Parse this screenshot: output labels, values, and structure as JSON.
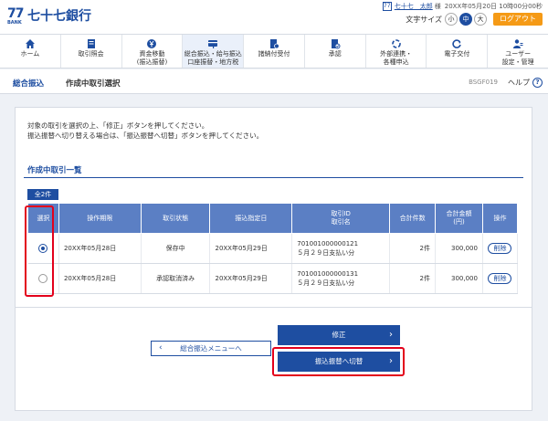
{
  "header": {
    "logo_mark": "77",
    "logo_sub": "BANK",
    "bank_name": "七十七銀行",
    "user_icon": "user-card-icon",
    "user_name": "七十七　太郎",
    "user_suffix": "様",
    "login_time": "20XX年05月20日 10時00分00秒",
    "font_size_label": "文字サイズ",
    "font_sizes": [
      "小",
      "中",
      "大"
    ],
    "font_size_selected": "中",
    "logout_label": "ログアウト"
  },
  "nav": {
    "items": [
      {
        "label": "ホーム",
        "icon": "home-icon"
      },
      {
        "label": "取引照会",
        "icon": "document-icon"
      },
      {
        "label": "資金移動\n(振込振替)",
        "icon": "yen-icon"
      },
      {
        "label": "総合振込・給与振込\n口座振替・地方税",
        "icon": "card-icon"
      },
      {
        "label": "諸納付受付",
        "icon": "payment-icon"
      },
      {
        "label": "承認",
        "icon": "approve-icon"
      },
      {
        "label": "外部連携・\n各種申込",
        "icon": "link-icon"
      },
      {
        "label": "電子交付",
        "icon": "refresh-icon"
      },
      {
        "label": "ユーザー\n設定・管理",
        "icon": "user-settings-icon"
      }
    ],
    "active_index": 3
  },
  "breadcrumb": {
    "parent": "総合振込",
    "current": "作成中取引選択",
    "screen_id": "BSGF019",
    "help_label": "ヘルプ",
    "help_icon": "help-icon"
  },
  "instructions": {
    "line1": "対象の取引を選択の上、「修正」ボタンを押してください。",
    "line2": "振込振替へ切り替える場合は、「振込振替へ切替」ボタンを押してください。"
  },
  "list": {
    "title": "作成中取引一覧",
    "count": "全2件",
    "headers": [
      "選択",
      "操作期限",
      "取引状態",
      "振込指定日",
      "取引ID\n取引名",
      "合計件数",
      "合計金額\n(円)",
      "操作"
    ],
    "rows": [
      {
        "selected": true,
        "deadline": "20XX年05月28日",
        "status": "保存中",
        "date": "20XX年05月29日",
        "id": "701001000000121",
        "name": "５月２９日支払い分",
        "count": "2件",
        "amount": "300,000",
        "action": "削除"
      },
      {
        "selected": false,
        "deadline": "20XX年05月28日",
        "status": "承認取消済み",
        "date": "20XX年05月29日",
        "id": "701001000000131",
        "name": "５月２９日支払い分",
        "count": "2件",
        "amount": "300,000",
        "action": "削除"
      }
    ]
  },
  "buttons": {
    "modify": "修正",
    "switch": "振込振替へ切替",
    "back": "総合振込メニューへ"
  },
  "colors": {
    "brand": "#1e4ea1",
    "accent": "#f59a16",
    "highlight": "#e3001b"
  }
}
